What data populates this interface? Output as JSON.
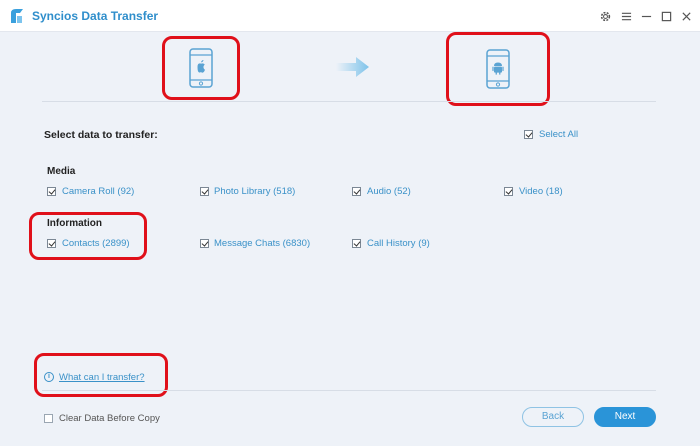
{
  "window": {
    "title": "Syncios Data Transfer"
  },
  "colors": {
    "accent": "#2f8ecb",
    "highlight": "#e0101a",
    "background": "#eef2f8"
  },
  "devices": {
    "source_icon": "iphone-apple-icon",
    "target_icon": "android-phone-icon"
  },
  "selection": {
    "heading": "Select data to transfer:",
    "select_all": "Select All"
  },
  "media": {
    "title": "Media",
    "items": [
      "Camera Roll (92)",
      "Photo Library (518)",
      "Audio (52)",
      "Video (18)"
    ]
  },
  "information": {
    "title": "Information",
    "items": [
      "Contacts (2899)",
      "Message Chats (6830)",
      "Call History (9)"
    ]
  },
  "help": {
    "link": "What can I transfer?"
  },
  "footer": {
    "clear_data": "Clear Data Before Copy",
    "back": "Back",
    "next": "Next"
  }
}
